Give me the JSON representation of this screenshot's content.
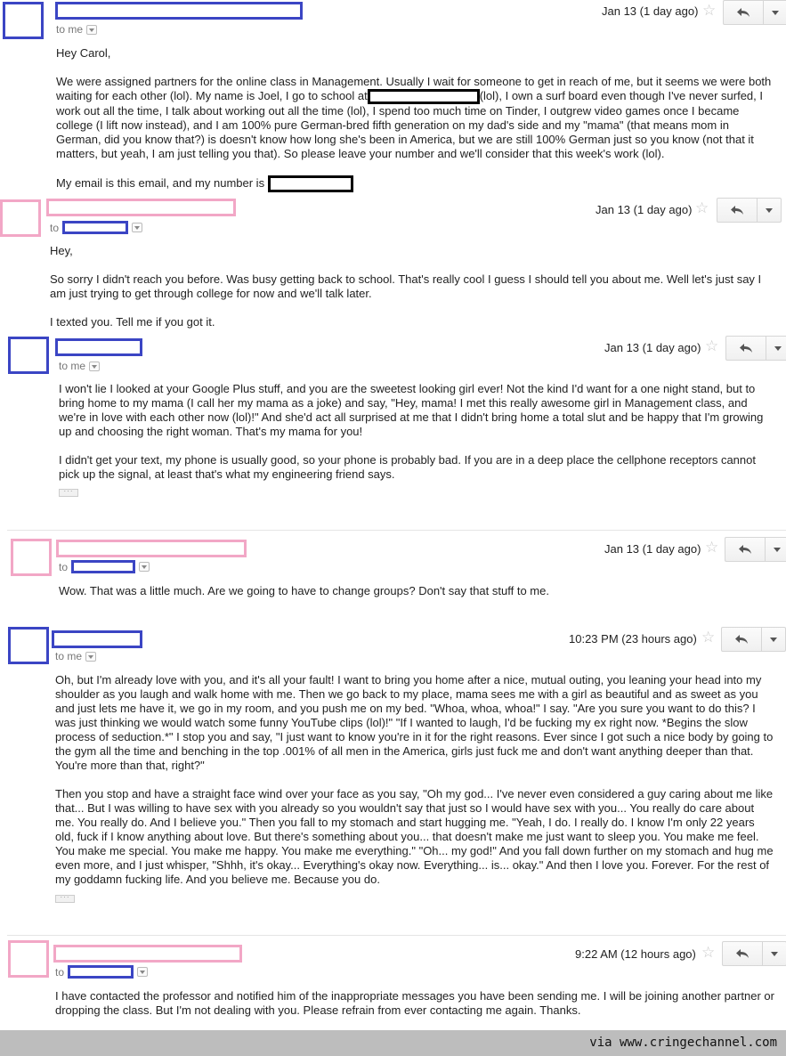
{
  "messages": [
    {
      "date": "Jan 13 (1 day ago)",
      "recipient": "to me",
      "body": [
        "Hey Carol,",
        "We were assigned partners for the online class in Management. Usually I wait for someone to get in reach of me, but it seems we were both waiting for each other (lol). My name is Joel, I go to school at",
        "(lol), I own a surf board even though I've never surfed, I work out all the time, I talk about working out all the time (lol), I spend too much time on Tinder, I outgrew video games once I became college (I lift now instead), and I am 100% pure German-bred fifth generation on my dad's side and my \"mama\" (that means mom in German, did you know that?) is doesn't know how long she's been in America, but we are still 100% German just so you know (not that it matters, but yeah, I am just telling you that). So please leave your number and we'll consider that this week's work (lol).",
        "My email is this email, and my number is"
      ]
    },
    {
      "date": "Jan 13 (1 day ago)",
      "recipient": "to",
      "body": [
        "Hey,",
        "So sorry I didn't reach you before. Was busy getting back to school. That's really cool I guess I should tell you about me. Well let's just say I am just trying to get through college for now and we'll talk later.",
        "I texted you. Tell me if you got it."
      ]
    },
    {
      "date": "Jan 13 (1 day ago)",
      "recipient": "to me",
      "body": [
        "I won't lie I looked at your Google Plus stuff, and you are the sweetest looking girl ever! Not the kind I'd want for a one night stand, but to bring home to my mama (I call her my mama as a joke) and say, \"Hey, mama! I met this really awesome girl in Management class, and we're in love with each other now (lol)!\" And she'd act all surprised at me that I didn't bring home a total slut and be happy that I'm growing up and choosing the right woman. That's my mama for you!",
        "I didn't get your text, my phone is usually good, so your phone is probably bad. If you are in a deep place the cellphone receptors cannot pick up the signal, at least that's what my engineering friend says."
      ]
    },
    {
      "date": "Jan 13 (1 day ago)",
      "recipient": "to",
      "body": [
        "Wow. That was a little much. Are we going to have to change groups? Don't say that stuff to me."
      ]
    },
    {
      "date": "10:23 PM (23 hours ago)",
      "recipient": "to me",
      "body": [
        "Oh, but I'm already love with you, and it's all your fault! I want to bring you home after a nice, mutual outing, you leaning your head into my shoulder as you laugh and walk home with me. Then we go back to my place, mama sees me with a girl as beautiful and as sweet as you and just lets me have it, we go in my room, and you push me on my bed. \"Whoa, whoa, whoa!\" I say. \"Are you sure you want to do this? I was just thinking we would watch some funny YouTube clips (lol)!\" \"If I wanted to laugh, I'd be fucking my ex right now. *Begins the slow process of seduction.*\" I stop you and say, \"I just want to know you're in it for the right reasons. Ever since I got such a nice body by going to the gym all the time and benching in the top .001% of all men in the America, girls just fuck me and don't want anything deeper than that. You're more than that, right?\"",
        "Then you stop and have a straight face wind over your face as you say, \"Oh my god... I've never even considered a guy caring about me like that... But I was willing to have sex with you already so you wouldn't say that just so I would have sex with you... You really do care about me. You really do. And I believe you.\" Then you fall to my stomach and start hugging me. \"Yeah, I do. I really do. I know I'm only 22 years old, fuck if I know anything about love. But there's something about you... that doesn't make me just want to sleep you. You make me feel. You make me special. You make me happy. You make me everything.\" \"Oh... my god!\" And you fall down further on my stomach and hug me even more, and I just whisper, \"Shhh, it's okay... Everything's okay now. Everything... is... okay.\" And then I love you. Forever. For the rest of my goddamn fucking life. And you believe me. Because you do."
      ]
    },
    {
      "date": "9:22 AM (12 hours ago)",
      "recipient": "to",
      "body": [
        "I have contacted the professor and notified him of the inappropriate messages you have been sending me. I will be joining another partner or dropping the class. But I'm not dealing with you. Please refrain from ever contacting me again. Thanks."
      ]
    }
  ],
  "icons": {
    "star": "star-icon",
    "reply": "reply-arrow-icon",
    "more": "chevron-down-icon"
  },
  "footer": {
    "credit": "via www.cringechannel.com"
  }
}
